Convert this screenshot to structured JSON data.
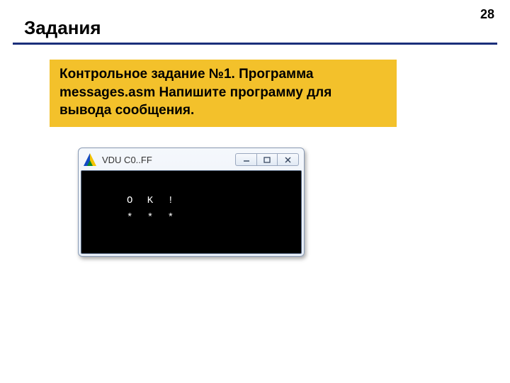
{
  "page": {
    "number": "28",
    "title": "Задания"
  },
  "task": {
    "text": "Контрольное задание №1.  Программа messages.asm Напишите программу для вывода сообщения."
  },
  "window": {
    "title": "VDU C0..FF",
    "output_line1": "O K !",
    "output_line2": "* * *"
  }
}
